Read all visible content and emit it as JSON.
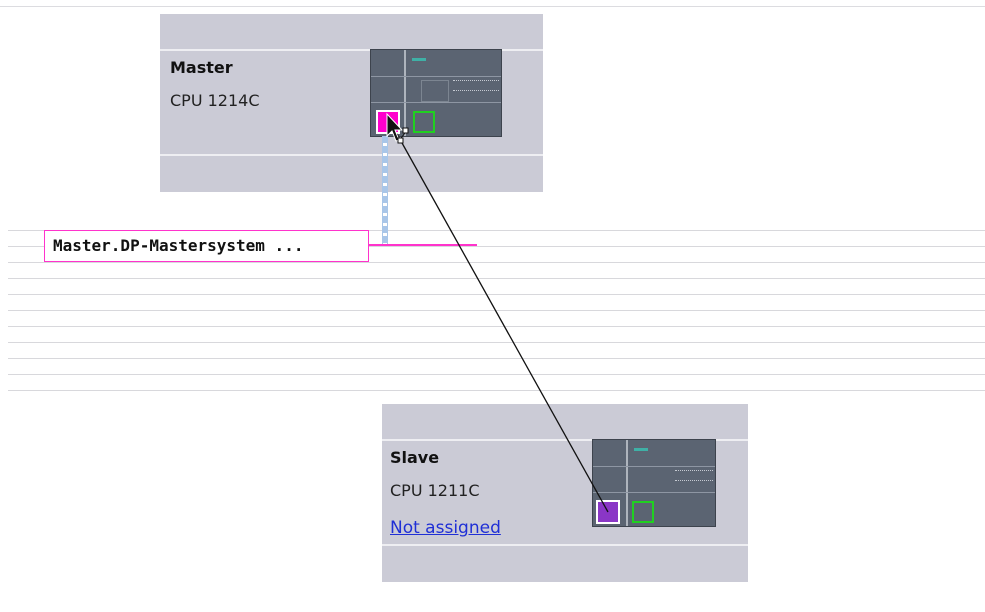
{
  "network_view": {
    "subnet": {
      "label": "Master.DP-Mastersystem ...",
      "color": "#ff33cc"
    },
    "devices": [
      {
        "name": "Master",
        "type": "CPU 1214C",
        "port_color": "#ff00cc"
      },
      {
        "name": "Slave",
        "type": "CPU 1211C",
        "status_link": "Not assigned",
        "port_color": "#8a36c6"
      }
    ]
  }
}
